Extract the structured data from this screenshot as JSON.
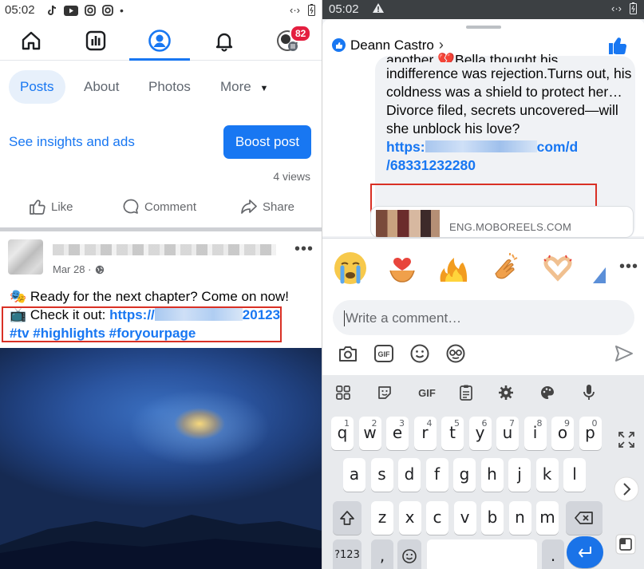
{
  "left": {
    "status": {
      "time": "05:02"
    },
    "nav": {
      "badge_count": "82"
    },
    "tabs": {
      "posts": "Posts",
      "about": "About",
      "photos": "Photos",
      "more": "More"
    },
    "insights_link": "See insights and ads",
    "boost_button": "Boost post",
    "views": "4 views",
    "actions": {
      "like": "Like",
      "comment": "Comment",
      "share": "Share"
    },
    "post": {
      "date": "Mar 28 ·",
      "line1": "Ready for the next chapter? Come on now!",
      "line2_prefix": "Check it out: ",
      "link_start": "https://",
      "link_end": "20123",
      "hashtags": "#tv #highlights #foryourpage"
    }
  },
  "right": {
    "status": {
      "time": "05:02"
    },
    "commenter": "Deann Castro",
    "comment": {
      "line_partial": "another",
      "line_partial_2": "Bella thought his",
      "body": "indifference was rejection.Turns out, his coldness was a shield to protect her…",
      "line_end": "Divorce filed, secrets uncovered—will she unblock his love?",
      "link_start": "https:",
      "link_end": "com/d",
      "link_line2": "/68331232280"
    },
    "preview_domain": "ENG.MOBOREELS.COM",
    "comment_placeholder": "Write a comment…",
    "keyboard": {
      "row1": [
        "q",
        "w",
        "e",
        "r",
        "t",
        "y",
        "u",
        "i",
        "o",
        "p"
      ],
      "row1_nums": [
        "1",
        "2",
        "3",
        "4",
        "5",
        "6",
        "7",
        "8",
        "9",
        "0"
      ],
      "row2": [
        "a",
        "s",
        "d",
        "f",
        "g",
        "h",
        "j",
        "k",
        "l"
      ],
      "row3": [
        "z",
        "x",
        "c",
        "v",
        "b",
        "n",
        "m"
      ],
      "sym_key": "?123",
      "comma": ",",
      "period": ".",
      "gif_label": "GIF"
    }
  }
}
